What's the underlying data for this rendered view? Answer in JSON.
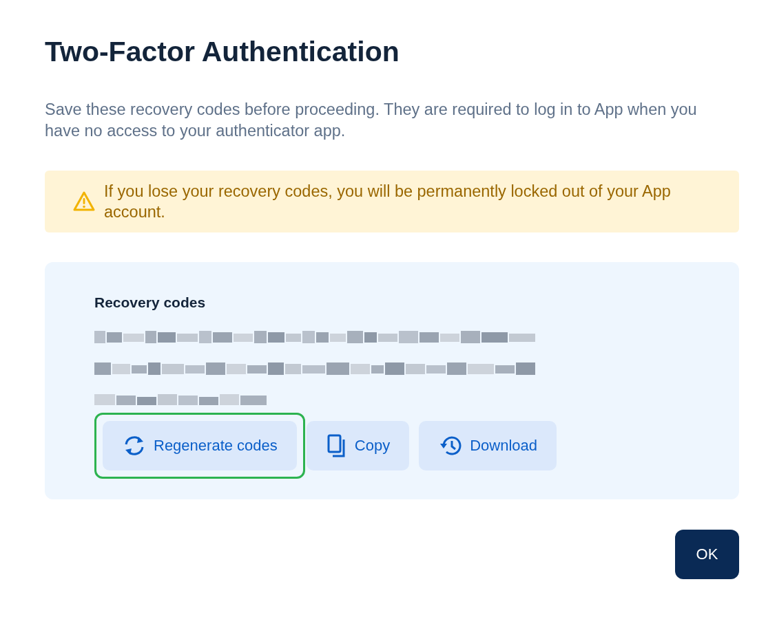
{
  "title": "Two-Factor Authentication",
  "description": "Save these recovery codes before proceeding. They are required to log in to App when you have no access to your authenticator app.",
  "warning": {
    "text": "If you lose your recovery codes, you will be permanently locked out of your App account."
  },
  "codes_panel": {
    "heading": "Recovery codes",
    "buttons": [
      {
        "label": "Regenerate codes",
        "kind": "regenerate",
        "focused": true
      },
      {
        "label": "Copy",
        "kind": "copy",
        "focused": false
      },
      {
        "label": "Download",
        "kind": "download",
        "focused": false
      }
    ]
  },
  "ok_button": {
    "label": "OK"
  }
}
